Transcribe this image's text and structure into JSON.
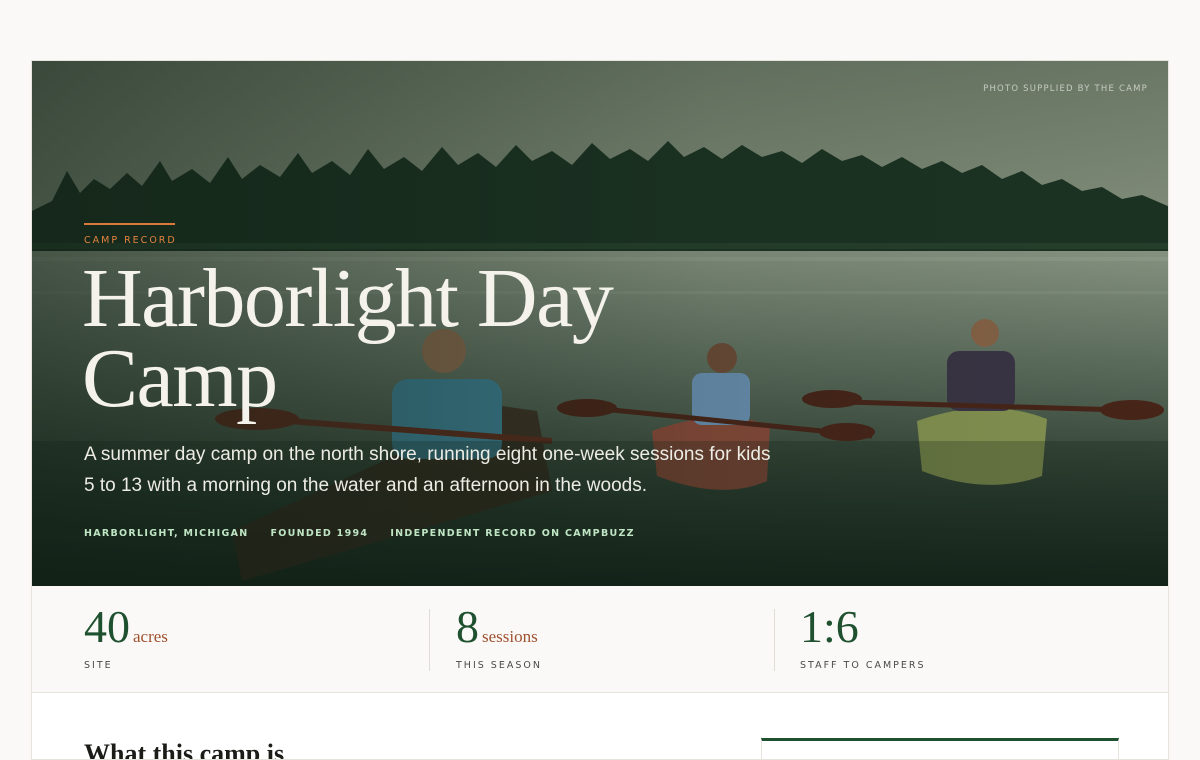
{
  "hero": {
    "photo_credit": "PHOTO SUPPLIED BY THE CAMP",
    "eyebrow": "CAMP RECORD",
    "title": "Harborlight Day Camp",
    "description": "A summer day camp on the north shore, running eight one-week sessions for kids 5 to 13 with a morning on the water and an afternoon in the woods.",
    "meta": [
      "HARBORLIGHT, MICHIGAN",
      "FOUNDED 1994",
      "INDEPENDENT RECORD ON CAMPBUZZ"
    ]
  },
  "stats": [
    {
      "value": "40",
      "unit": "acres",
      "label": "SITE"
    },
    {
      "value": "8",
      "unit": "sessions",
      "label": "THIS SEASON"
    },
    {
      "value": "1:6",
      "unit": "",
      "label": "STAFF TO CAMPERS"
    }
  ],
  "section": {
    "heading": "What this camp is"
  },
  "colors": {
    "accent_green": "#1f5130",
    "accent_orange": "#d9793a",
    "unit_rust": "#a0512f",
    "background": "#faf9f7"
  }
}
